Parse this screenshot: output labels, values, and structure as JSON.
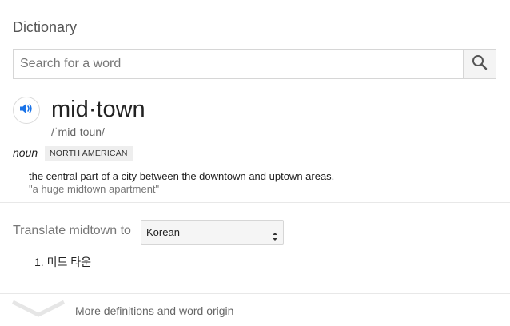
{
  "card": {
    "title": "Dictionary"
  },
  "search": {
    "placeholder": "Search for a word",
    "value": ""
  },
  "entry": {
    "headword": "mid·town",
    "phonetic": "/ˈmidˌtoun/",
    "part_of_speech": "noun",
    "region_badge": "NORTH AMERICAN",
    "definition": "the central part of a city between the downtown and uptown areas.",
    "example": "\"a huge midtown apartment\""
  },
  "translate": {
    "label": "Translate midtown to",
    "selected_language": "Korean",
    "results": [
      "1. 미드 타운"
    ]
  },
  "footer": {
    "more_label": "More definitions and word origin"
  },
  "colors": {
    "accent_blue": "#1a73e8",
    "divider": "#e8e8e8"
  }
}
